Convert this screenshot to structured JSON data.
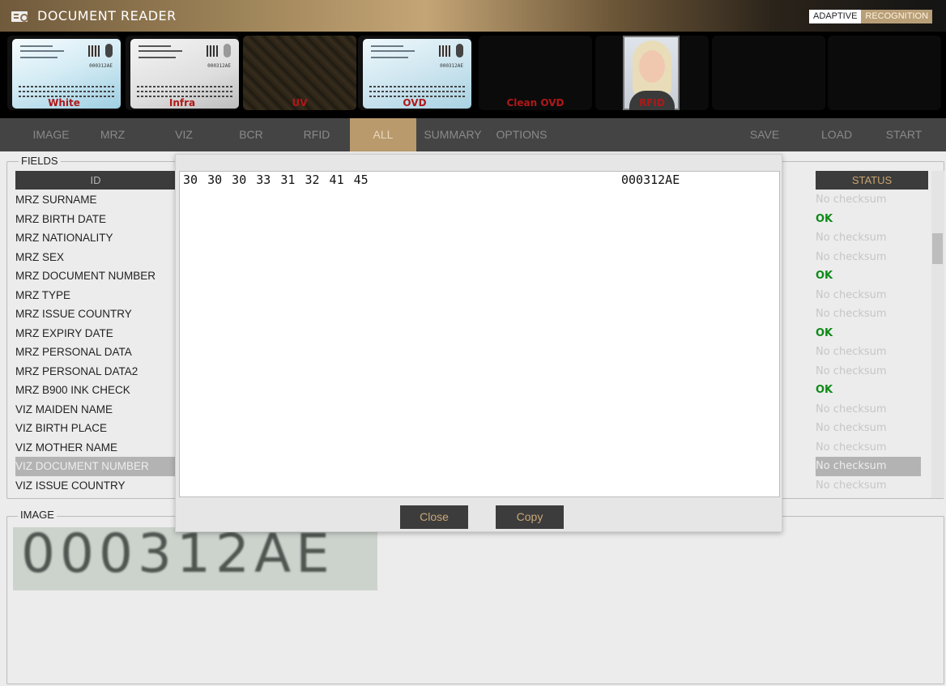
{
  "app": {
    "title": "DOCUMENT READER",
    "brand_part1": "ADAPTIVE",
    "brand_part2": "RECOGNITION",
    "accent_color": "#b99a6d"
  },
  "thumbnails": [
    {
      "label": "White"
    },
    {
      "label": "Infra"
    },
    {
      "label": "UV"
    },
    {
      "label": "OVD"
    },
    {
      "label": "Clean OVD"
    },
    {
      "label": "RFID"
    },
    {
      "label": ""
    },
    {
      "label": ""
    }
  ],
  "card": {
    "number": "000312AE"
  },
  "nav": {
    "image": "IMAGE",
    "mrz": "MRZ",
    "viz": "VIZ",
    "bcr": "BCR",
    "rfid": "RFID",
    "all": "ALL",
    "summary": "SUMMARY",
    "options": "OPTIONS",
    "save": "SAVE",
    "load": "LOAD",
    "start": "START",
    "active": "ALL"
  },
  "fields": {
    "legend": "FIELDS",
    "id_header": "ID",
    "status_header": "STATUS",
    "rows": [
      {
        "id": "MRZ SURNAME",
        "status": "No checksum"
      },
      {
        "id": "MRZ BIRTH DATE",
        "status": "OK"
      },
      {
        "id": "MRZ NATIONALITY",
        "status": "No checksum"
      },
      {
        "id": "MRZ SEX",
        "status": "No checksum"
      },
      {
        "id": "MRZ DOCUMENT NUMBER",
        "status": "OK"
      },
      {
        "id": "MRZ TYPE",
        "status": "No checksum"
      },
      {
        "id": "MRZ ISSUE COUNTRY",
        "status": "No checksum"
      },
      {
        "id": "MRZ EXPIRY DATE",
        "status": "OK"
      },
      {
        "id": "MRZ PERSONAL DATA",
        "status": "No checksum"
      },
      {
        "id": "MRZ PERSONAL DATA2",
        "status": "No checksum"
      },
      {
        "id": "MRZ B900 INK CHECK",
        "status": "OK"
      },
      {
        "id": "VIZ MAIDEN NAME",
        "status": "No checksum"
      },
      {
        "id": "VIZ BIRTH PLACE",
        "status": "No checksum"
      },
      {
        "id": "VIZ MOTHER NAME",
        "status": "No checksum"
      },
      {
        "id": "VIZ DOCUMENT NUMBER",
        "status": "No checksum"
      },
      {
        "id": "VIZ ISSUE COUNTRY",
        "status": "No checksum"
      }
    ],
    "selected_row": "VIZ DOCUMENT NUMBER"
  },
  "image_section": {
    "legend": "IMAGE",
    "crop_text": "000312AE"
  },
  "dialog": {
    "hex": "30 30 30 33 31 32 41 45",
    "ascii": "000312AE",
    "close_label": "Close",
    "copy_label": "Copy"
  }
}
